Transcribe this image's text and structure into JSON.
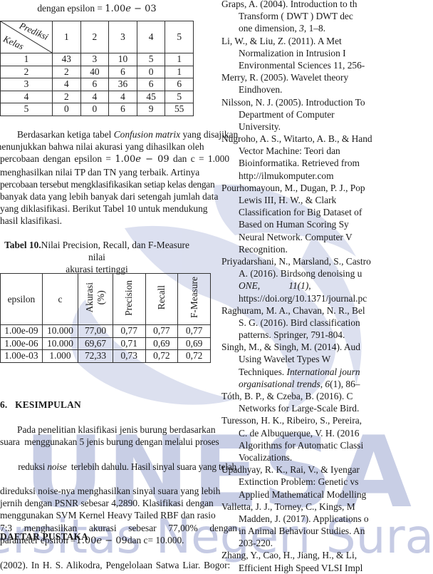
{
  "table9_caption": {
    "prefix": "dengan epsilon = ",
    "math_value": "1.00",
    "math_e": "e",
    "math_rest": " − 03"
  },
  "confusion_matrix": {
    "corner_top_label": "Prediksi",
    "corner_bottom_label": "Kelas",
    "columns": [
      "1",
      "2",
      "3",
      "4",
      "5"
    ],
    "rows": [
      {
        "kelas": "1",
        "values": [
          "43",
          "3",
          "10",
          "5",
          "1"
        ]
      },
      {
        "kelas": "2",
        "values": [
          "2",
          "40",
          "6",
          "0",
          "1"
        ]
      },
      {
        "kelas": "3",
        "values": [
          "4",
          "6",
          "36",
          "6",
          "6"
        ]
      },
      {
        "kelas": "4",
        "values": [
          "2",
          "4",
          "4",
          "45",
          "5"
        ]
      },
      {
        "kelas": "5",
        "values": [
          "0",
          "0",
          "6",
          "9",
          "55"
        ]
      }
    ]
  },
  "paragraph_results": {
    "lines": [
      {
        "parts": [
          "Berdasarkan ketiga tabel ",
          "Confusion matrix",
          " yang disajikan"
        ]
      },
      "menunjukkan bahwa nilai akurasi yang dihasilkan oleh",
      {
        "math_line": [
          "percobaan dengan epsilon = ",
          "1.00",
          "e",
          " − 09",
          " dan c = 1.000"
        ]
      },
      "menghasilkan nilai TP dan TN yang terbaik. Artinya",
      "percobaan tersebut mengklasifikasikan setiap kelas dengan",
      "banyak data yang lebih banyak dari setengah jumlah data",
      "yang diklasifikasi. Berikut Tabel 10 untuk mendukung",
      "hasil klasifikasi."
    ]
  },
  "table10": {
    "caption_bold": "Tabel 10.",
    "caption_line1": "Nilai Precision, Recall, dan F-Measure nilai",
    "caption_line2": "akurasi tertinggi",
    "headers": [
      "epsilon",
      "c",
      "Akurasi",
      "(%)",
      "Precision",
      "Recall",
      "F-Measure"
    ],
    "rows": [
      {
        "epsilon": "1.00e-09",
        "c": "10.000",
        "akurasi": "77,00",
        "precision": "0,77",
        "recall": "0,77",
        "fmeasure": "0,77"
      },
      {
        "epsilon": "1.00e-06",
        "c": "10.000",
        "akurasi": "69,67",
        "precision": "0,71",
        "recall": "0,69",
        "fmeasure": "0,69"
      },
      {
        "epsilon": "1.00e-03",
        "c": "1.000",
        "akurasi": "72,33",
        "precision": "0,73",
        "recall": "0,72",
        "fmeasure": "0,72"
      }
    ]
  },
  "section6": {
    "number": "6.",
    "title": "KESIMPULAN",
    "lines": [
      "Pada penelitian klasifikasi jenis burung berdasarkan",
      "suara  menggunakan 5 jenis burung dengan melalui proses",
      {
        "parts": [
          "reduksi ",
          "noise",
          "  terlebih dahulu. Hasil sinyal suara yang telah"
        ]
      },
      "direduksi noise-nya menghasilkan sinyal suara yang lebih",
      "jernih dengan PSNR sebesar 4,2890. Klasifikasi dengan",
      "menggunakan SVM Kernel Heavy Tailed RBF dan rasio",
      "7:3  menghasilkan  akurasi  sebesar  77,00%  dengan",
      {
        "math_line": [
          "parameter epsilon =",
          "1.00",
          "e",
          " − 09",
          "dan c= 10.000."
        ]
      }
    ]
  },
  "references_heading": "DAFTAR PUSTAKA",
  "left_reference_fragment": "(2002). In H. S. Alikodra, Pengelolaan Satwa Liar. Bogor:",
  "references": [
    {
      "lines": [
        "Graps, A. (2004). Introduction to th",
        "Transform ( DWT ) DWT dec",
        "one dimension, 3, 1–8."
      ],
      "italic_fragment": "3"
    },
    {
      "lines": [
        "Li, W., & Liu, Z. (2011). A Met",
        "Normalization in Intrusion I",
        "Environmental Sciences 11, 256-"
      ]
    },
    {
      "lines": [
        "Merry, R. (2005). Wavelet theory",
        "Eindhoven."
      ]
    },
    {
      "lines": [
        "Nilsson, N. J. (2005). Introduction To",
        "Department of Computer",
        "University."
      ]
    },
    {
      "lines": [
        "Nugroho, A. S., Witarto, A. B., & Hand",
        "Vector Machine: Teori dan",
        "Bioinformatika. Retrieved from",
        "http://ilmukomputer.com"
      ]
    },
    {
      "lines": [
        "Pourhomayoun, M., Dugan, P. J., Pop",
        "Lewis III, H. W., & Clark",
        "Classification for Big Dataset of",
        "Based on Human Scoring Sy",
        "Neural Network. Computer V",
        "Recognition."
      ]
    },
    {
      "lines": [
        "Priyadarshani, N., Marsland, S., Castro",
        "A. (2016). Birdsong denoising u",
        "ONE,            11(1),",
        "https://doi.org/10.1371/journal.pc"
      ],
      "italic_line": 2
    },
    {
      "lines": [
        "Raghuram, M. A., Chavan, N. R., Bel",
        "S. G. (2016). Bird classification",
        "patterns. Springer, 791-804."
      ]
    },
    {
      "lines": [
        "Singh, M., & Singh, M. (2014). Aud",
        "Using Wavelet Types W",
        "Techniques. International journ",
        "organisational trends, 6(1), 86–"
      ]
    },
    {
      "lines": [
        "Tóth, B. P., & Czeba, B. (2016). C",
        "Networks for Large-Scale Bird."
      ]
    },
    {
      "lines": [
        "Turesson, H. K., Ribeiro, S., Pereira,",
        "C. de Albuquerque, V. H. (2016",
        "Algorithms for Automatic Classi",
        "Vocalizations."
      ]
    },
    {
      "lines": [
        "Upadhyay, R. K., Rai, V., & Iyengar",
        "Extinction Problem: Genetic vs",
        "Applied Mathematical Modelling"
      ]
    },
    {
      "lines": [
        "Valletta, J. J., Torney, C., Kings, M",
        "Madden, J. (2017). Applications o",
        "in Animal Behaviour Studies. An",
        "203-220."
      ]
    },
    {
      "lines": [
        "Zhang, Y., Cao, H., Jiang, H., & Li,",
        "Efficient High Speed VLSI Impl"
      ]
    }
  ],
  "watermark": {
    "text_large": "UNESA",
    "text_sub": "Universitas Negeri Surabaya",
    "color": "#c3c9e3"
  }
}
